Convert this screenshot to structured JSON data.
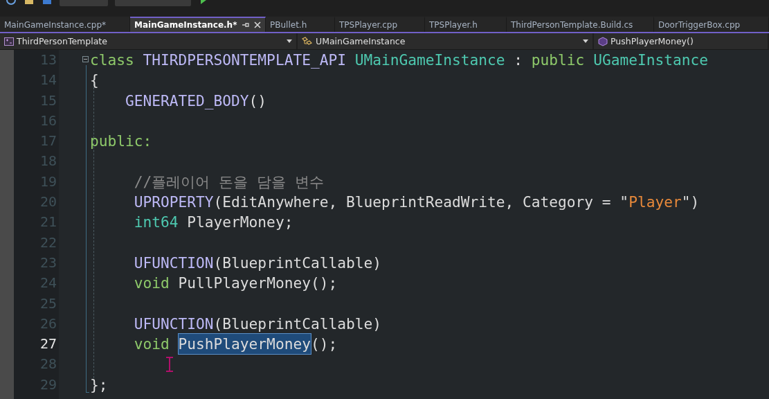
{
  "tabs": [
    {
      "label": "MainGameInstance.cpp*",
      "selected": false
    },
    {
      "label": "MainGameInstance.h*",
      "selected": true
    },
    {
      "label": "PBullet.h",
      "selected": false
    },
    {
      "label": "TPSPlayer.cpp",
      "selected": false
    },
    {
      "label": "TPSPlayer.h",
      "selected": false
    },
    {
      "label": "ThirdPersonTemplate.Build.cs",
      "selected": false
    },
    {
      "label": "DoorTriggerBox.cpp",
      "selected": false
    }
  ],
  "navigation": {
    "project": "ThirdPersonTemplate",
    "scope": "UMainGameInstance",
    "member": "PushPlayerMoney()"
  },
  "lines": [
    {
      "number": "13",
      "current": false,
      "fold": true,
      "tokens": [
        {
          "text": "class",
          "kind": "keyword",
          "highlighted": false
        },
        {
          "text": " THIRDPERSONTEMPLATE_API",
          "kind": "macro",
          "highlighted": false
        },
        {
          "text": " UMainGameInstance",
          "kind": "type",
          "highlighted": false
        },
        {
          "text": " : ",
          "kind": "plain",
          "highlighted": false
        },
        {
          "text": "public",
          "kind": "keyword",
          "highlighted": false
        },
        {
          "text": " UGameInstance",
          "kind": "type",
          "highlighted": false
        }
      ]
    },
    {
      "number": "14",
      "current": false,
      "fold": false,
      "tokens": [
        {
          "text": "{",
          "kind": "plain",
          "highlighted": false
        }
      ]
    },
    {
      "number": "15",
      "current": false,
      "fold": false,
      "tokens": [
        {
          "text": "    GENERATED_BODY",
          "kind": "macro",
          "highlighted": false
        },
        {
          "text": "()",
          "kind": "plain",
          "highlighted": false
        }
      ]
    },
    {
      "number": "16",
      "current": false,
      "fold": false
    },
    {
      "number": "17",
      "current": false,
      "fold": false,
      "tokens": [
        {
          "text": "public:",
          "kind": "keyword",
          "highlighted": false
        }
      ]
    },
    {
      "number": "18",
      "current": false,
      "fold": false
    },
    {
      "number": "19",
      "current": false,
      "fold": false,
      "tokens": [
        {
          "text": "     //플레이어 돈을 담을 변수",
          "kind": "comment",
          "highlighted": false
        }
      ]
    },
    {
      "number": "20",
      "current": false,
      "fold": false,
      "tokens": [
        {
          "text": "     UPROPERTY",
          "kind": "macro",
          "highlighted": false
        },
        {
          "text": "(EditAnywhere, BlueprintReadWrite, Category = \"",
          "kind": "plain",
          "highlighted": false
        },
        {
          "text": "Player",
          "kind": "string",
          "highlighted": false
        },
        {
          "text": "\")",
          "kind": "plain",
          "highlighted": false
        }
      ]
    },
    {
      "number": "21",
      "current": false,
      "fold": false,
      "tokens": [
        {
          "text": "     int64",
          "kind": "type",
          "highlighted": false
        },
        {
          "text": " PlayerMoney;",
          "kind": "plain",
          "highlighted": false
        }
      ]
    },
    {
      "number": "22",
      "current": false,
      "fold": false
    },
    {
      "number": "23",
      "current": false,
      "fold": false,
      "tokens": [
        {
          "text": "     UFUNCTION",
          "kind": "macro",
          "highlighted": false
        },
        {
          "text": "(BlueprintCallable)",
          "kind": "plain",
          "highlighted": false
        }
      ]
    },
    {
      "number": "24",
      "current": false,
      "fold": false,
      "tokens": [
        {
          "text": "     void",
          "kind": "keyword",
          "highlighted": false
        },
        {
          "text": " PullPlayerMoney();",
          "kind": "plain",
          "highlighted": false
        }
      ]
    },
    {
      "number": "25",
      "current": false,
      "fold": false
    },
    {
      "number": "26",
      "current": false,
      "fold": false,
      "tokens": [
        {
          "text": "     UFUNCTION",
          "kind": "macro",
          "highlighted": false
        },
        {
          "text": "(BlueprintCallable)",
          "kind": "plain",
          "highlighted": false
        }
      ]
    },
    {
      "number": "27",
      "current": true,
      "fold": false,
      "tokens": [
        {
          "text": "     void ",
          "kind": "keyword",
          "highlighted": false
        },
        {
          "text": "PushPlayerMoney",
          "kind": "plain",
          "highlighted": true
        },
        {
          "text": "();",
          "kind": "plain",
          "highlighted": false
        }
      ]
    },
    {
      "number": "28",
      "current": false,
      "fold": false
    },
    {
      "number": "29",
      "current": false,
      "fold": false,
      "tokens": [
        {
          "text": "};",
          "kind": "plain",
          "highlighted": false
        }
      ]
    }
  ]
}
